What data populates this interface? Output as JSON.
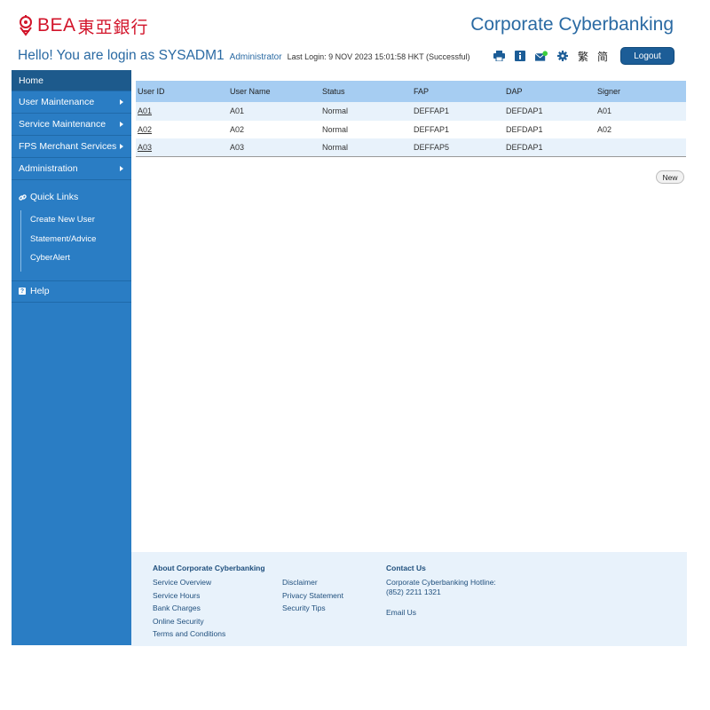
{
  "brand": {
    "name": "BEA",
    "name_cn": "東亞銀行",
    "brand_color": "#d2142a"
  },
  "header": {
    "app_title": "Corporate Cyberbanking",
    "greeting": "Hello! You are login as",
    "user": "SYSADM1",
    "role": "Administrator",
    "last_login": "Last Login: 9 NOV 2023 15:01:58 HKT (Successful)",
    "toolbar": [
      "print-icon",
      "info-icon",
      "mail-icon",
      "gear-icon"
    ],
    "lang_traditional": "繁",
    "lang_simplified": "简",
    "logout_label": "Logout"
  },
  "sidebar": {
    "home": "Home",
    "menu": [
      {
        "label": "User Maintenance"
      },
      {
        "label": "Service Maintenance"
      },
      {
        "label": "FPS Merchant Services"
      },
      {
        "label": "Administration"
      }
    ],
    "quick_links_title": "Quick Links",
    "quick_links": [
      "Create New User",
      "Statement/Advice",
      "CyberAlert"
    ],
    "help": "Help"
  },
  "table": {
    "columns": [
      "User ID",
      "User Name",
      "Status",
      "FAP",
      "DAP",
      "Signer"
    ],
    "rows": [
      [
        "A01",
        "A01",
        "Normal",
        "DEFFAP1",
        "DEFDAP1",
        "A01"
      ],
      [
        "A02",
        "A02",
        "Normal",
        "DEFFAP1",
        "DEFDAP1",
        "A02"
      ],
      [
        "A03",
        "A03",
        "Normal",
        "DEFFAP5",
        "DEFDAP1",
        ""
      ]
    ]
  },
  "new_button": "New",
  "footer": {
    "about_title": "About Corporate Cyberbanking",
    "about_col1": [
      "Service Overview",
      "Service Hours",
      "Bank Charges",
      "Online Security",
      "Terms and Conditions"
    ],
    "about_col2": [
      "Disclaimer",
      "Privacy Statement",
      "Security Tips"
    ],
    "contact_title": "Contact Us",
    "hotline_label": "Corporate Cyberbanking Hotline:",
    "hotline_number": "(852) 2211 1321",
    "email_us": "Email Us"
  },
  "colors": {
    "primary": "#1c5d97",
    "sidebar": "#2a7dc4",
    "table_header": "#a6cdf2",
    "row_alt": "#e8f2fb"
  }
}
